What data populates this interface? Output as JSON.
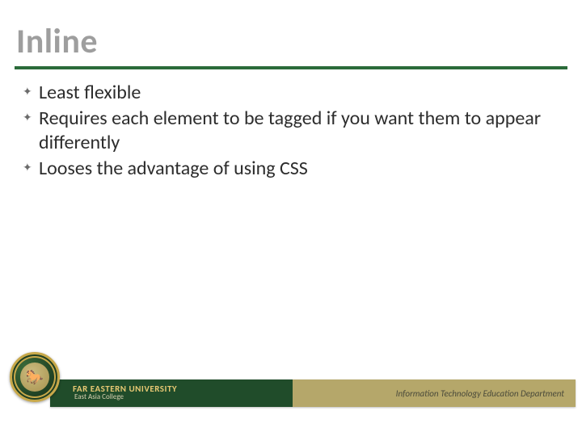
{
  "title": "Inline",
  "bullets": [
    "Least flexible",
    "Requires each element to be tagged if you want them to appear differently",
    "Looses the advantage of using CSS"
  ],
  "footer": {
    "university": "FAR EASTERN UNIVERSITY",
    "college": "East Asia College",
    "department": "Information Technology Education Department"
  },
  "colors": {
    "accent_green": "#2b6b3a",
    "title_gray": "#9e9e9e",
    "footer_dark": "#204c2a",
    "footer_gold": "#b5a76a"
  }
}
